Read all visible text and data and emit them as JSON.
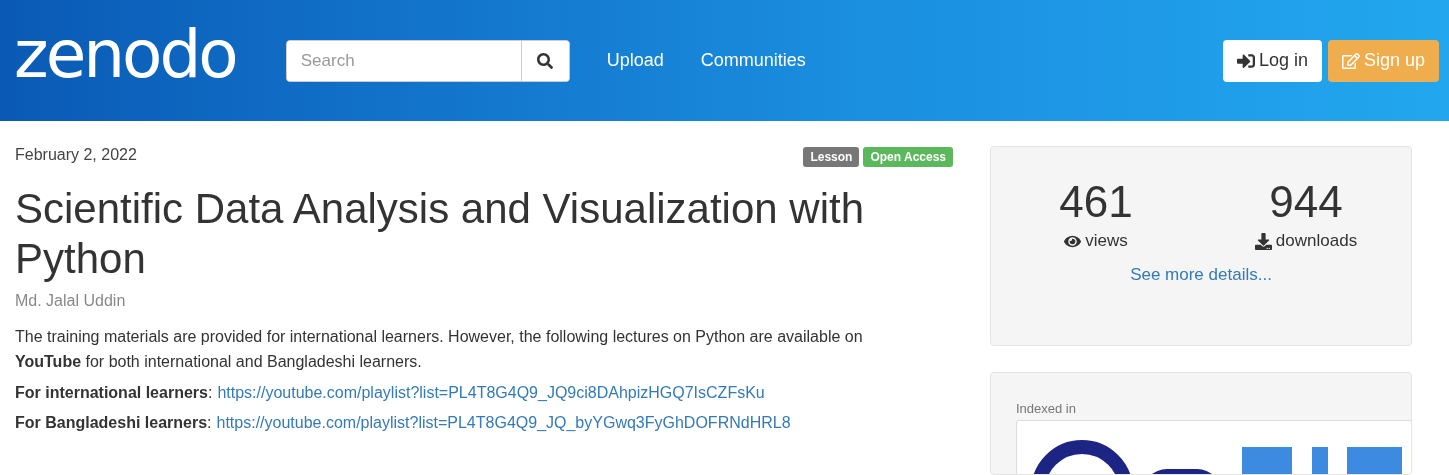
{
  "header": {
    "logo": "zenodo",
    "search": {
      "placeholder": "Search"
    },
    "nav": [
      "Upload",
      "Communities"
    ],
    "login": "Log in",
    "signup": "Sign up"
  },
  "record": {
    "date": "February 2, 2022",
    "badges": [
      {
        "label": "Lesson",
        "color": "#777777"
      },
      {
        "label": "Open Access",
        "color": "#5cb85c"
      }
    ],
    "title": "Scientific Data Analysis and Visualization with Python",
    "author": "Md. Jalal Uddin",
    "description": "The training materials are provided for international learners. However, the following lectures on Python are available on **YouTube** for both international and Bangladeshi learners.",
    "links": [
      {
        "label": "**For international learners**:",
        "url": "https://youtube.com/playlist?list=PL4T8G4Q9_JQ9ci8DAhpizHGQ7IsCZFsKu"
      },
      {
        "label": "**For Bangladeshi learners**:",
        "url": "https://youtube.com/playlist?list=PL4T8G4Q9_JQ_byYGwq3FyGhDOFRNdHRL8"
      }
    ]
  },
  "stats": {
    "items": [
      {
        "kind": "views",
        "count": "461",
        "label": "views"
      },
      {
        "kind": "downloads",
        "count": "944",
        "label": "downloads"
      }
    ],
    "details_link": "See more details..."
  },
  "indexed": {
    "label": "Indexed in"
  }
}
